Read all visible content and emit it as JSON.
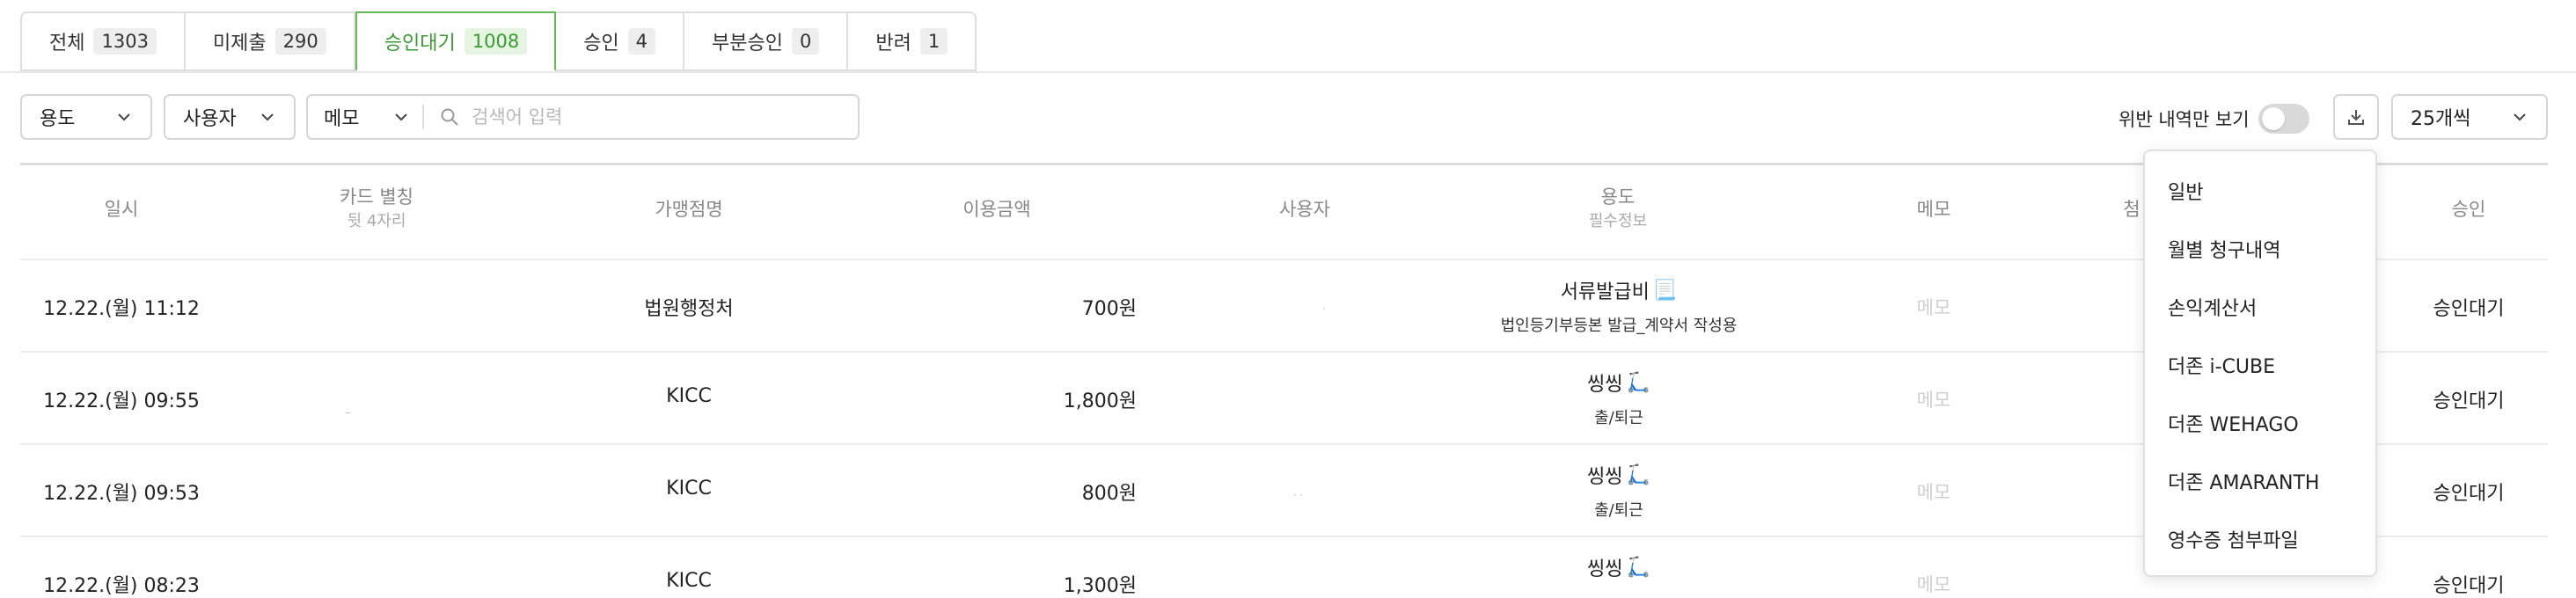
{
  "tabs": [
    {
      "label": "전체",
      "count": "1303"
    },
    {
      "label": "미제출",
      "count": "290"
    },
    {
      "label": "승인대기",
      "count": "1008"
    },
    {
      "label": "승인",
      "count": "4"
    },
    {
      "label": "부분승인",
      "count": "0"
    },
    {
      "label": "반려",
      "count": "1"
    }
  ],
  "active_tab": 2,
  "filters": {
    "purpose": "용도",
    "user": "사용자",
    "memo": "메모",
    "search_placeholder": "검색어 입력",
    "violation_only": "위반 내역만 보기",
    "violation_toggle_on": false,
    "page_size": "25개씩"
  },
  "table": {
    "headers": {
      "datetime": "일시",
      "card_alias": "카드 별칭",
      "card_alias_sub": "뒷 4자리",
      "merchant": "가맹점명",
      "amount": "이용금액",
      "user": "사용자",
      "purpose": "용도",
      "purpose_sub": "필수정보",
      "memo": "메모",
      "receipt_partial": "첨",
      "approval": "승인"
    },
    "rows": [
      {
        "datetime": "12.22.(월) 11:12",
        "merchant": "법원행정처",
        "amount": "700원",
        "purpose": "서류발급비",
        "purpose_icon": "document-emoji",
        "detail": "법인등기부등본 발급_계약서 작성용",
        "memo": "메모",
        "status": "승인대기"
      },
      {
        "datetime": "12.22.(월) 09:55",
        "merchant": "KICC",
        "amount": "1,800원",
        "purpose": "씽씽",
        "purpose_icon": "scooter-emoji",
        "detail": "출/퇴근",
        "memo": "메모",
        "status": "승인대기"
      },
      {
        "datetime": "12.22.(월) 09:53",
        "merchant": "KICC",
        "amount": "800원",
        "purpose": "씽씽",
        "purpose_icon": "scooter-emoji",
        "detail": "출/퇴근",
        "memo": "메모",
        "status": "승인대기"
      },
      {
        "datetime": "12.22.(월) 08:23",
        "merchant": "KICC",
        "amount": "1,300원",
        "purpose": "씽씽",
        "purpose_icon": "scooter-emoji",
        "detail": "",
        "memo": "메모",
        "status": "승인대기"
      }
    ]
  },
  "download_menu": {
    "items": [
      "일반",
      "월별 청구내역",
      "손익계산서",
      "더존 i-CUBE",
      "더존 WEHAGO",
      "더존 AMARANTH",
      "영수증 첨부파일"
    ]
  },
  "colors": {
    "accent": "#3a9a33",
    "accent_border": "#65b95a",
    "accent_bg": "#e6f4e2"
  }
}
